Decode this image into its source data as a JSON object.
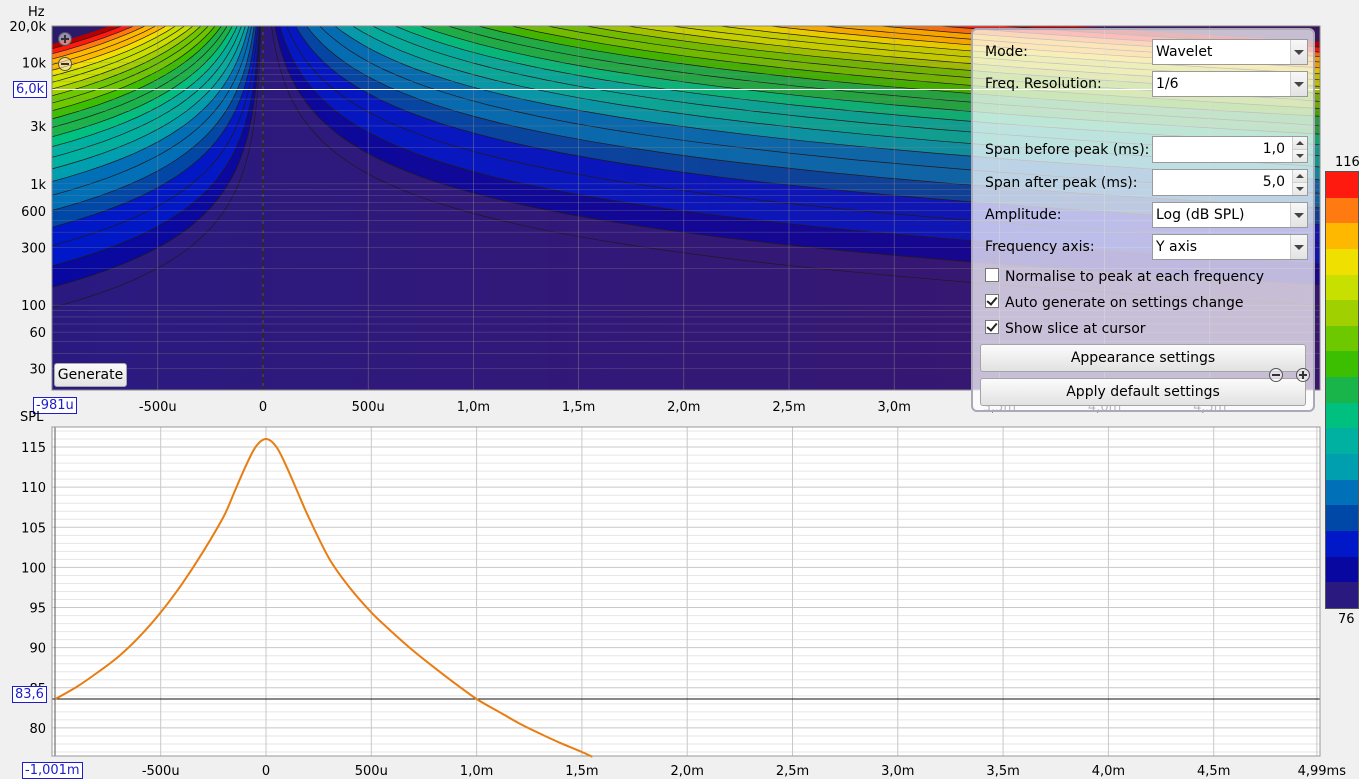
{
  "spectrogram": {
    "y_unit": "Hz",
    "y_ticks": [
      "20,0k",
      "10k",
      "3k",
      "1k",
      "600",
      "300",
      "100",
      "60",
      "30"
    ],
    "y_tick_values": [
      20000,
      10000,
      3000,
      1000,
      600,
      300,
      100,
      60,
      30
    ],
    "x_ticks": [
      "-500u",
      "0",
      "500u",
      "1,0m",
      "1,5m",
      "2,0m",
      "2,5m",
      "3,0m",
      "3,5m",
      "4,0m",
      "4,5m"
    ],
    "x_tick_values": [
      -0.5,
      0,
      0.5,
      1.0,
      1.5,
      2.0,
      2.5,
      3.0,
      3.5,
      4.0,
      4.5
    ],
    "x_range_ms": [
      -0.981,
      5.0
    ],
    "y_range_hz": [
      20,
      20000
    ],
    "cursor_freq_label": "6,0k",
    "cursor_time_label": "-981u",
    "generate_label": "Generate"
  },
  "settings": {
    "mode_label": "Mode:",
    "mode_value": "Wavelet",
    "freq_res_label": "Freq. Resolution:",
    "freq_res_value": "1/6",
    "span_before_label": "Span before peak (ms):",
    "span_before_value": "1,0",
    "span_after_label": "Span after peak (ms):",
    "span_after_value": "5,0",
    "amplitude_label": "Amplitude:",
    "amplitude_value": "Log (dB SPL)",
    "freq_axis_label": "Frequency axis:",
    "freq_axis_value": "Y axis",
    "normalise_label": "Normalise to peak at each frequency",
    "normalise_checked": false,
    "auto_generate_label": "Auto generate on settings change",
    "auto_generate_checked": true,
    "show_slice_label": "Show slice at cursor",
    "show_slice_checked": true,
    "appearance_button": "Appearance settings",
    "apply_default_button": "Apply default settings"
  },
  "color_scale": {
    "max_label": "116",
    "min_label": "76",
    "colors": [
      "#ff1a10",
      "#ff7a10",
      "#ffb800",
      "#f0e000",
      "#c8e000",
      "#a0d000",
      "#6ec800",
      "#3cbf00",
      "#19b44a",
      "#00c080",
      "#00b0a0",
      "#009fb0",
      "#0070b8",
      "#0048a8",
      "#0018c8",
      "#0808a0",
      "#2a1a80"
    ]
  },
  "chart_data": {
    "type": "line",
    "title": "",
    "xlabel": "",
    "ylabel": "SPL",
    "x_unit": "ms",
    "x_ticks": [
      "-500u",
      "0",
      "500u",
      "1,0m",
      "1,5m",
      "2,0m",
      "2,5m",
      "3,0m",
      "3,5m",
      "4,0m",
      "4,5m",
      "4,99ms"
    ],
    "x_tick_values": [
      -0.5,
      0,
      0.5,
      1.0,
      1.5,
      2.0,
      2.5,
      3.0,
      3.5,
      4.0,
      4.5,
      4.99
    ],
    "y_ticks": [
      "115",
      "110",
      "105",
      "100",
      "95",
      "90",
      "85",
      "80"
    ],
    "y_tick_values": [
      115,
      110,
      105,
      100,
      95,
      90,
      85,
      80
    ],
    "xlim": [
      -1.001,
      4.99
    ],
    "ylim": [
      76.5,
      117.5
    ],
    "cursor_value_label": "83,6",
    "cursor_time_label": "-1,001m",
    "cursor_value": 83.6,
    "grid": true,
    "series": [
      {
        "color": "#e87d12",
        "x": [
          -1.0,
          -0.9,
          -0.8,
          -0.7,
          -0.6,
          -0.5,
          -0.4,
          -0.3,
          -0.2,
          -0.15,
          -0.1,
          -0.05,
          0.0,
          0.05,
          0.1,
          0.15,
          0.2,
          0.3,
          0.4,
          0.5,
          0.6,
          0.7,
          0.8,
          0.9,
          1.0,
          1.1,
          1.2,
          1.3,
          1.4,
          1.5,
          1.55
        ],
        "y": [
          83.6,
          85.1,
          86.9,
          88.9,
          91.4,
          94.4,
          97.9,
          101.9,
          106.4,
          109.4,
          112.4,
          115.0,
          116.0,
          115.0,
          112.4,
          109.4,
          106.4,
          101.1,
          97.4,
          94.4,
          91.9,
          89.6,
          87.5,
          85.5,
          83.6,
          82.1,
          80.6,
          79.3,
          78.1,
          77.0,
          76.4
        ]
      }
    ]
  }
}
